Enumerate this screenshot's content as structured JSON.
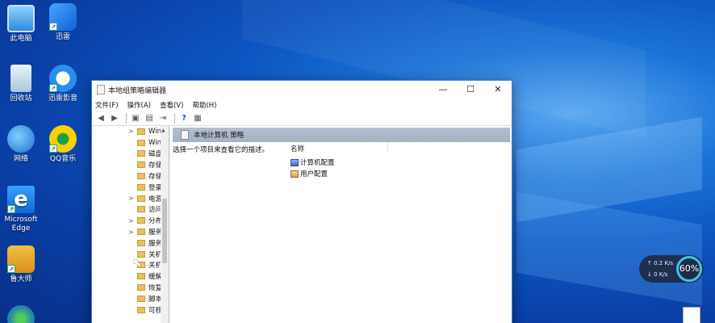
{
  "desktop": {
    "icons": [
      {
        "label": "此电脑",
        "icon": "this-pc-icon"
      },
      {
        "label": "迅雷",
        "icon": "xunlei-icon"
      },
      {
        "label": "回收站",
        "icon": "recycle-bin-icon"
      },
      {
        "label": "迅雷影音",
        "icon": "xunlei-video-icon"
      },
      {
        "label": "网络",
        "icon": "network-icon"
      },
      {
        "label": "QQ音乐",
        "icon": "qq-music-icon"
      },
      {
        "label": "Microsoft\nEdge",
        "icon": "edge-icon"
      },
      {
        "label": "鲁大师",
        "icon": "ludashi-icon"
      }
    ],
    "edge_label_line1": "Microsoft",
    "edge_label_line2": "Edge"
  },
  "window": {
    "title": "本地组策略编辑器",
    "controls": {
      "minimize": "—",
      "maximize": "☐",
      "close": "✕"
    },
    "menu": [
      "文件(F)",
      "操作(A)",
      "查看(V)",
      "帮助(H)"
    ],
    "toolbar_glyphs": {
      "back": "◀",
      "forward": "▶",
      "up": "▣",
      "show": "▤",
      "export": "⇥",
      "help": "?",
      "props": "▦"
    },
    "tree_items": [
      {
        "label": "Windo",
        "expandable": true
      },
      {
        "label": "Windo",
        "expandable": false
      },
      {
        "label": "磁盘配",
        "expandable": false
      },
      {
        "label": "存储驱",
        "expandable": false
      },
      {
        "label": "存储运",
        "expandable": false
      },
      {
        "label": "登录",
        "expandable": false
      },
      {
        "label": "电源管",
        "expandable": true
      },
      {
        "label": "访问拒",
        "expandable": false
      },
      {
        "label": "分布式",
        "expandable": true
      },
      {
        "label": "服务控",
        "expandable": true
      },
      {
        "label": "服务器",
        "expandable": false
      },
      {
        "label": "关机",
        "expandable": false
      },
      {
        "label": "关机选",
        "expandable": false
      },
      {
        "label": "缓解选",
        "expandable": false
      },
      {
        "label": "恢复",
        "expandable": false
      },
      {
        "label": "脚本",
        "expandable": false
      },
      {
        "label": "可移动",
        "expandable": false
      }
    ],
    "expand_glyph": ">",
    "pane_header": "本地计算机 策略",
    "description": "选择一个项目来查看它的描述。",
    "column_name": "名称",
    "list_items": [
      {
        "label": "计算机配置",
        "icon": "computer-config-icon"
      },
      {
        "label": "用户配置",
        "icon": "user-config-icon"
      }
    ]
  },
  "netwidget": {
    "up": "0.2",
    "up_unit": "K/s",
    "down": "0",
    "down_unit": "K/s",
    "percent": "60%"
  }
}
